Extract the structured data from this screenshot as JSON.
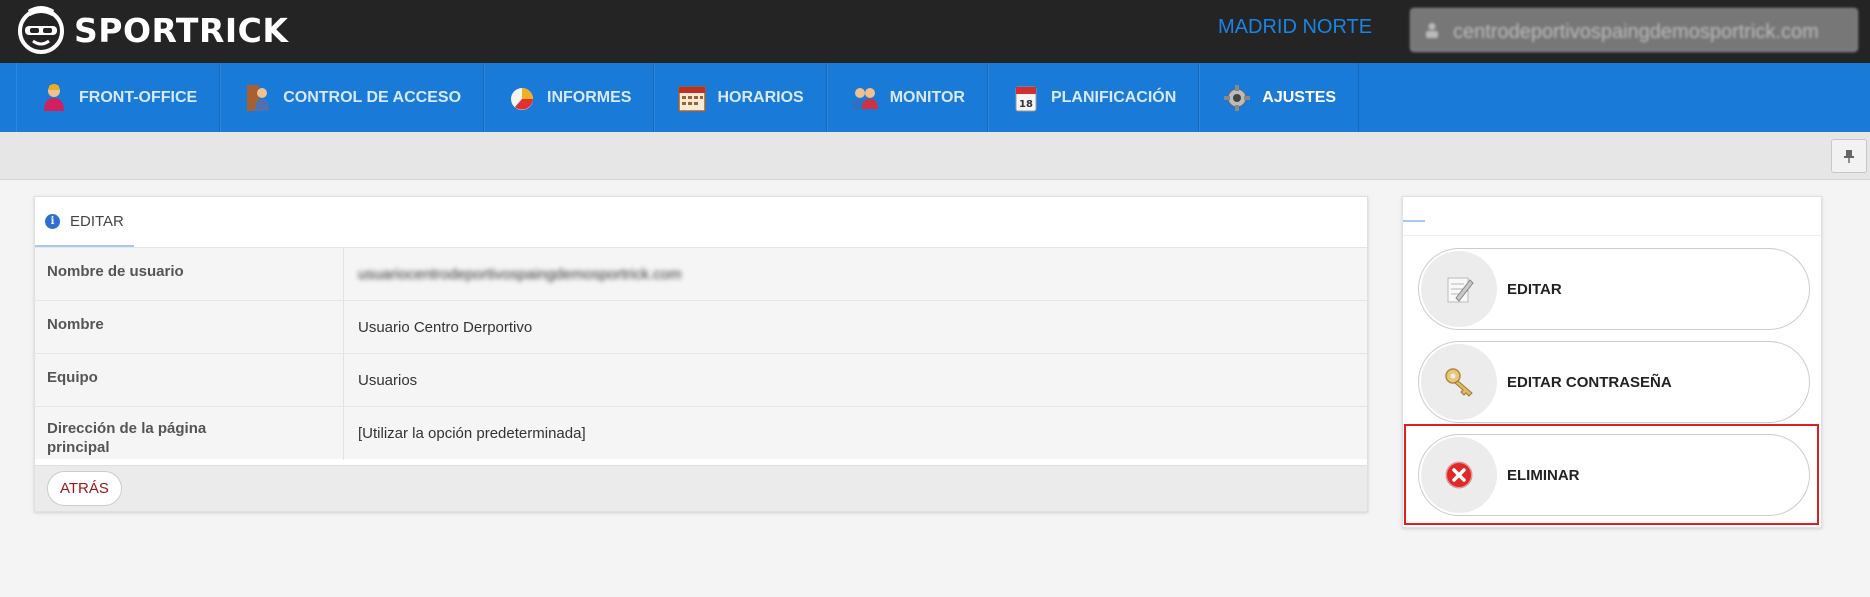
{
  "header": {
    "brand": "SPORTRICK",
    "site_name": "MADRID NORTE",
    "user_email": "centrodeportivospaingdemosportrick.com"
  },
  "nav": {
    "items": [
      {
        "label": "FRONT-OFFICE",
        "icon": "person-icon"
      },
      {
        "label": "CONTROL DE ACCESO",
        "icon": "access-control-icon"
      },
      {
        "label": "INFORMES",
        "icon": "pie-chart-icon"
      },
      {
        "label": "HORARIOS",
        "icon": "calendar-grid-icon"
      },
      {
        "label": "MONITOR",
        "icon": "people-icon"
      },
      {
        "label": "PLANIFICACIÓN",
        "icon": "calendar-icon"
      },
      {
        "label": "AJUSTES",
        "icon": "gear-icon",
        "active": true
      }
    ]
  },
  "panel": {
    "tab_label": "EDITAR",
    "rows": [
      {
        "label": "Nombre de usuario",
        "value": "usuariocentrodeportivospaingdemosportrick.com"
      },
      {
        "label": "Nombre",
        "value": "Usuario Centro Derportivo"
      },
      {
        "label": "Equipo",
        "value": "Usuarios"
      },
      {
        "label": "Dirección de la página principal",
        "value": "[Utilizar la opción predeterminada]"
      }
    ],
    "back_label": "ATRÁS"
  },
  "actions": [
    {
      "label": "EDITAR",
      "icon": "edit-document-icon"
    },
    {
      "label": "EDITAR CONTRASEÑA",
      "icon": "key-icon"
    },
    {
      "label": "ELIMINAR",
      "icon": "delete-icon"
    }
  ],
  "colors": {
    "topbar": "#242424",
    "nav": "#1a7ad8",
    "accent": "#1a84e4",
    "danger": "#e02020",
    "back": "#a01818"
  }
}
